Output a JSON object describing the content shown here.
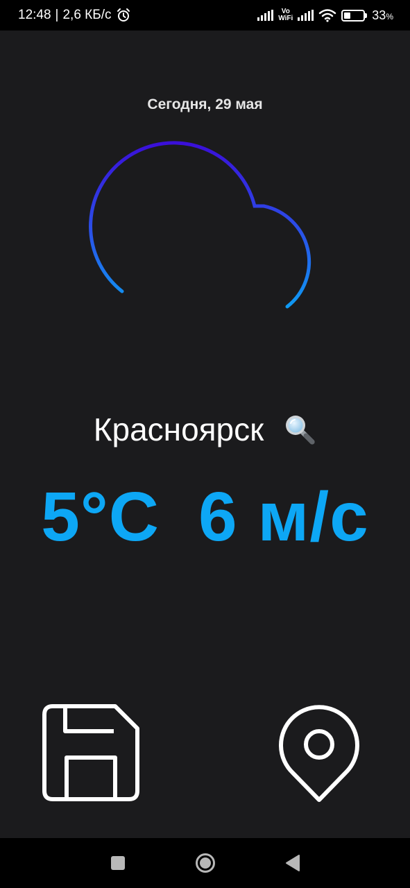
{
  "status_bar": {
    "time": "12:48",
    "speed": "2,6 КБ/с",
    "volte_top": "Vo",
    "volte_bottom": "WiFi",
    "battery_level": 0.33,
    "battery_value": "33",
    "battery_unit": "%"
  },
  "weather": {
    "date": "Сегодня, 29 мая",
    "condition_icon": "rain-cloud-icon",
    "city": "Красноярск",
    "temperature": "5°C",
    "wind": "6 м/с"
  },
  "actions": {
    "save_icon": "floppy-disk-icon",
    "location_icon": "map-pin-icon",
    "search_icon": "magnifier-icon"
  },
  "nav": {
    "recent_icon": "square-icon",
    "home_icon": "circle-icon",
    "back_icon": "triangle-back-icon"
  },
  "colors": {
    "background": "#1b1b1d",
    "accent": "#0da7f5",
    "icon_gradient_top": "#3a0fd9",
    "icon_gradient_bottom": "#0e9af3"
  }
}
